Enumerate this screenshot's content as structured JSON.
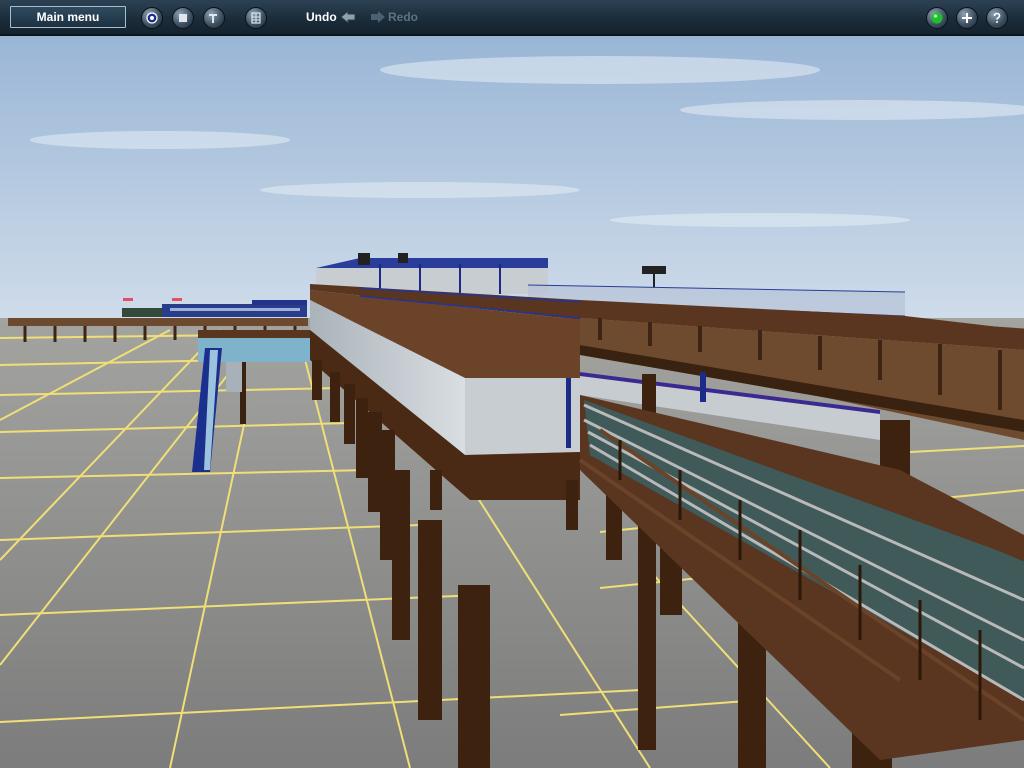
{
  "toolbar": {
    "main_menu_label": "Main menu",
    "undo_label": "Undo",
    "redo_label": "Redo",
    "left_icons": [
      "camera-icon",
      "stop-icon",
      "wrench-icon",
      "grid-icon"
    ],
    "right_icons": [
      "status-light-icon",
      "add-icon",
      "help-icon"
    ],
    "status_light_color": "#1fbf2a"
  },
  "scene": {
    "type": "3d-viewport",
    "subject": "elevated railway station on wooden trestles over baseboard grid",
    "colors": {
      "sky_top": "#9db8d8",
      "sky_horizon": "#c9d9e8",
      "ground": "#8d8d8d",
      "grid_lines": "#f2e27a",
      "timber": "#4a2a14",
      "platform_wall": "#c7cdd2",
      "canopy": "#1d2f8c"
    }
  }
}
